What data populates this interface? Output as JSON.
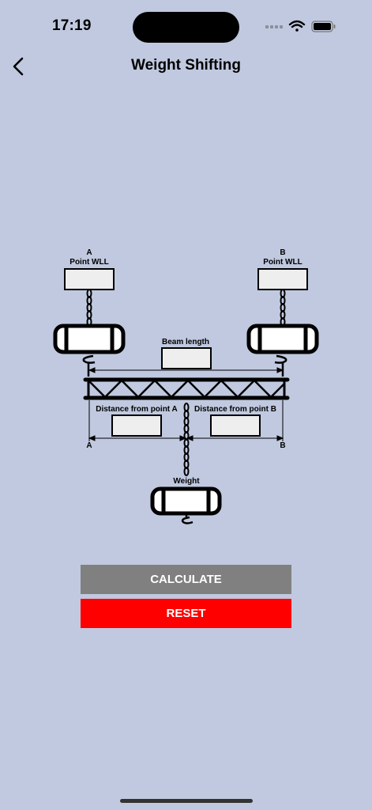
{
  "status_bar": {
    "time": "17:19"
  },
  "nav": {
    "title": "Weight Shifting",
    "back_icon": "chevron-left-icon"
  },
  "diagram": {
    "point_a_letter": "A",
    "point_a_label": "Point WLL",
    "point_b_letter": "B",
    "point_b_label": "Point WLL",
    "beam_length_label": "Beam length",
    "distance_a_label": "Distance from point A",
    "distance_b_label": "Distance from point B",
    "end_a_letter": "A",
    "end_b_letter": "B",
    "weight_label": "Weight",
    "inputs": {
      "point_a_wll": "",
      "point_b_wll": "",
      "beam_length": "",
      "distance_a": "",
      "distance_b": ""
    }
  },
  "buttons": {
    "calculate": "CALCULATE",
    "reset": "RESET"
  },
  "colors": {
    "background": "#c0c9df",
    "calculate": "#808080",
    "reset": "#ff0000"
  }
}
